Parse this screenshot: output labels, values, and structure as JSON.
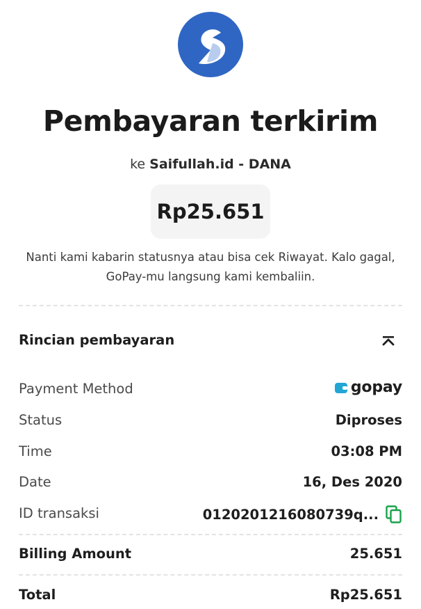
{
  "header": {
    "title": "Pembayaran terkirim",
    "recipient_prefix": "ke",
    "recipient_name": "Saifullah.id - DANA",
    "amount": "Rp25.651",
    "note_line1": "Nanti kami kabarin statusnya atau bisa cek Riwayat. Kalo gagal,",
    "note_line2": "GoPay-mu langsung kami kembaliin."
  },
  "details": {
    "section_title": "Rincian pembayaran",
    "collapse_icon": "chevron-up-double-icon",
    "payment_method_label": "Payment Method",
    "payment_method_value": "gopay",
    "status_label": "Status",
    "status_value": "Diproses",
    "time_label": "Time",
    "time_value": "03:08 PM",
    "date_label": "Date",
    "date_value": "16, Des 2020",
    "txid_label": "ID transaksi",
    "txid_value": "0120201216080739q...",
    "billing_label": "Billing Amount",
    "billing_value": "25.651",
    "total_label": "Total",
    "total_value": "Rp25.651"
  },
  "colors": {
    "brand_blue": "#2f66c4",
    "gopay_cyan": "#22a6d6",
    "copy_green": "#19a14a"
  }
}
